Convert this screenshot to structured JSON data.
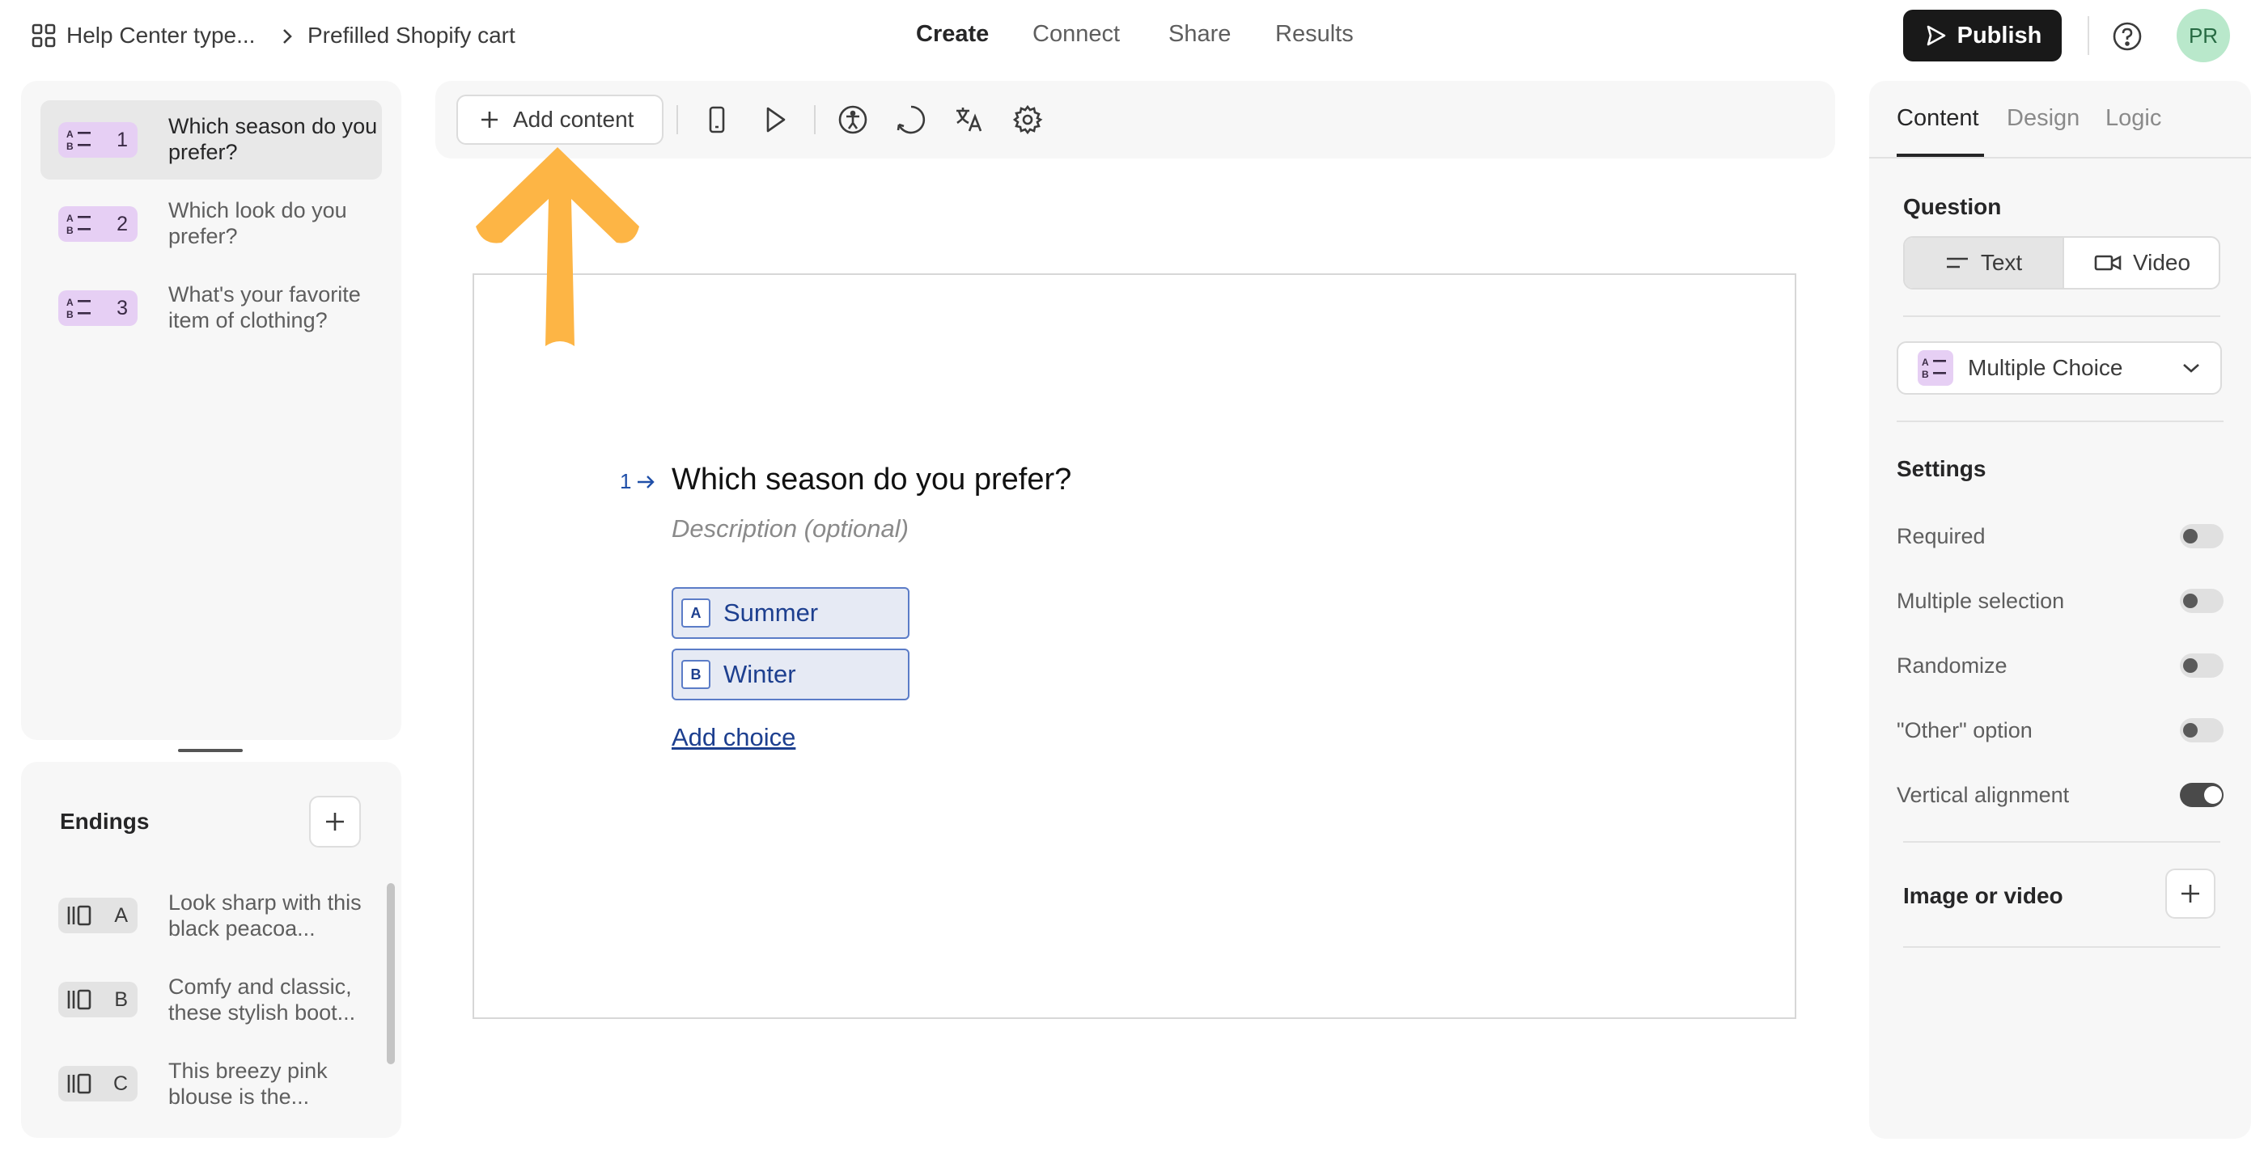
{
  "breadcrumb": {
    "workspace": "Help Center type...",
    "separator": ">",
    "form": "Prefilled Shopify cart"
  },
  "nav_tabs": [
    {
      "label": "Create",
      "active": true
    },
    {
      "label": "Connect",
      "active": false
    },
    {
      "label": "Share",
      "active": false
    },
    {
      "label": "Results",
      "active": false
    }
  ],
  "header": {
    "publish_label": "Publish",
    "avatar_initials": "PR"
  },
  "questions": [
    {
      "number": "1",
      "label": "Which season do you prefer?",
      "selected": true
    },
    {
      "number": "2",
      "label": "Which look do you prefer?",
      "selected": false
    },
    {
      "number": "3",
      "label": "What's your favorite item of clothing?",
      "selected": false
    }
  ],
  "endings": {
    "title": "Endings",
    "items": [
      {
        "key": "A",
        "label": "Look sharp with this black peacoa..."
      },
      {
        "key": "B",
        "label": "Comfy and classic, these stylish boot..."
      },
      {
        "key": "C",
        "label": "This breezy pink blouse is the..."
      }
    ]
  },
  "toolbar": {
    "add_content_label": "Add content"
  },
  "canvas": {
    "question_number": "1",
    "question_title": "Which season do you prefer?",
    "description_placeholder": "Description (optional)",
    "choices": [
      {
        "key": "A",
        "label": "Summer"
      },
      {
        "key": "B",
        "label": "Winter"
      }
    ],
    "add_choice_label": "Add choice"
  },
  "right_panel": {
    "tabs": [
      {
        "label": "Content",
        "active": true
      },
      {
        "label": "Design",
        "active": false
      },
      {
        "label": "Logic",
        "active": false
      }
    ],
    "question_label": "Question",
    "question_modes": [
      {
        "label": "Text",
        "active": true
      },
      {
        "label": "Video",
        "active": false
      }
    ],
    "question_type": "Multiple Choice",
    "settings_label": "Settings",
    "settings": [
      {
        "label": "Required",
        "on": false
      },
      {
        "label": "Multiple selection",
        "on": false
      },
      {
        "label": "Randomize",
        "on": false
      },
      {
        "label": "\"Other\" option",
        "on": false
      },
      {
        "label": "Vertical alignment",
        "on": true
      }
    ],
    "media_label": "Image or video"
  },
  "colors": {
    "accent_blue": "#1d3f8f",
    "question_badge": "#e6cff4",
    "annotation_arrow": "#fdb545",
    "publish_bg": "#191919"
  }
}
